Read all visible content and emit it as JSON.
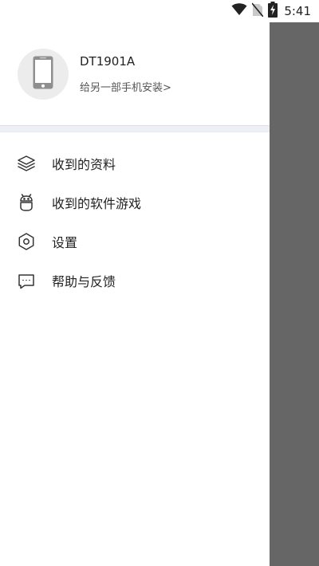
{
  "status_bar": {
    "time": "5:41",
    "icons": [
      "wifi-icon",
      "no-sim-icon",
      "battery-charging-icon"
    ]
  },
  "drawer": {
    "profile": {
      "device_name": "DT1901A",
      "install_link": "给另一部手机安装>",
      "avatar_icon": "phone-icon"
    },
    "menu": [
      {
        "label": "收到的资料",
        "icon": "layers-icon"
      },
      {
        "label": "收到的软件游戏",
        "icon": "android-icon"
      },
      {
        "label": "设置",
        "icon": "gear-icon"
      },
      {
        "label": "帮助与反馈",
        "icon": "chat-bubble-icon"
      }
    ]
  },
  "colors": {
    "scrim": "#666666",
    "divider": "#eef0f5",
    "avatar_bg": "#ececec"
  }
}
